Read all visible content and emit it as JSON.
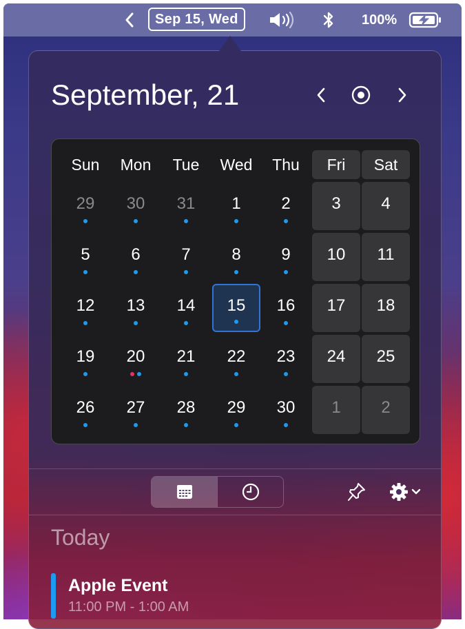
{
  "menubar": {
    "back_glyph": "‹",
    "date": "Sep 15, Wed",
    "volume_icon": "speaker-wave-icon",
    "bluetooth_icon": "bluetooth-icon",
    "battery_percent": "100%",
    "battery_icon": "battery-charging-icon"
  },
  "header": {
    "month": "September,",
    "year": "21"
  },
  "weekdays": [
    "Sun",
    "Mon",
    "Tue",
    "Wed",
    "Thu",
    "Fri",
    "Sat"
  ],
  "weeks": [
    [
      {
        "d": "29",
        "dim": true,
        "dots": [
          "blue"
        ]
      },
      {
        "d": "30",
        "dim": true,
        "dots": [
          "blue"
        ]
      },
      {
        "d": "31",
        "dim": true,
        "dots": [
          "blue"
        ]
      },
      {
        "d": "1",
        "dots": [
          "blue"
        ]
      },
      {
        "d": "2",
        "dots": [
          "blue"
        ]
      },
      {
        "d": "3",
        "dots": []
      },
      {
        "d": "4",
        "dots": []
      }
    ],
    [
      {
        "d": "5",
        "dots": [
          "blue"
        ]
      },
      {
        "d": "6",
        "dots": [
          "blue"
        ]
      },
      {
        "d": "7",
        "dots": [
          "blue"
        ]
      },
      {
        "d": "8",
        "dots": [
          "blue"
        ]
      },
      {
        "d": "9",
        "dots": [
          "blue"
        ]
      },
      {
        "d": "10",
        "dots": []
      },
      {
        "d": "11",
        "dots": []
      }
    ],
    [
      {
        "d": "12",
        "dots": [
          "blue"
        ]
      },
      {
        "d": "13",
        "dots": [
          "blue"
        ]
      },
      {
        "d": "14",
        "dots": [
          "blue"
        ]
      },
      {
        "d": "15",
        "today": true,
        "dots": [
          "blue"
        ]
      },
      {
        "d": "16",
        "dots": [
          "blue"
        ]
      },
      {
        "d": "17",
        "dots": []
      },
      {
        "d": "18",
        "dots": []
      }
    ],
    [
      {
        "d": "19",
        "dots": [
          "blue"
        ]
      },
      {
        "d": "20",
        "dots": [
          "red",
          "blue"
        ]
      },
      {
        "d": "21",
        "dots": [
          "blue"
        ]
      },
      {
        "d": "22",
        "dots": [
          "blue"
        ]
      },
      {
        "d": "23",
        "dots": [
          "blue"
        ]
      },
      {
        "d": "24",
        "dots": []
      },
      {
        "d": "25",
        "dots": []
      }
    ],
    [
      {
        "d": "26",
        "dots": [
          "blue"
        ]
      },
      {
        "d": "27",
        "dots": [
          "blue"
        ]
      },
      {
        "d": "28",
        "dots": [
          "blue"
        ]
      },
      {
        "d": "29",
        "dots": [
          "blue"
        ]
      },
      {
        "d": "30",
        "dots": [
          "blue"
        ]
      },
      {
        "d": "1",
        "dim": true,
        "dots": []
      },
      {
        "d": "2",
        "dim": true,
        "dots": []
      }
    ]
  ],
  "colors": {
    "dot_blue": "#1d9bf0",
    "dot_red": "#e8315b",
    "today_fill": "#1f3451",
    "today_border": "#2f74d6",
    "event_bar": "#1d9bf0"
  },
  "toolbar": {
    "calendar_view_icon": "calendar-icon",
    "clock_view_icon": "clock-icon",
    "pin_icon": "pin-icon",
    "settings_icon": "gear-icon"
  },
  "agenda": {
    "heading": "Today",
    "events": [
      {
        "title": "Apple Event",
        "time": "11:00 PM - 1:00 AM"
      }
    ]
  }
}
